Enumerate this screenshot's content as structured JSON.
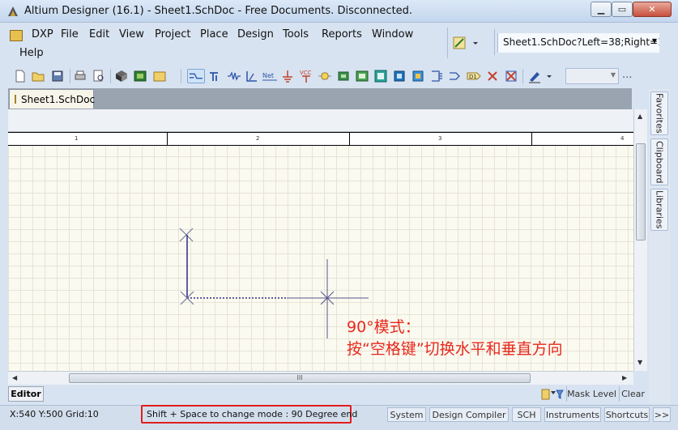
{
  "window": {
    "title": "Altium Designer (16.1) - Sheet1.SchDoc - Free Documents. Disconnected.",
    "min_glyph": "▁",
    "max_glyph": "▭",
    "close_glyph": "✕"
  },
  "menu": {
    "items": [
      "DXP",
      "File",
      "Edit",
      "View",
      "Project",
      "Place",
      "Design",
      "Tools",
      "Reports",
      "Window",
      "Help"
    ]
  },
  "address": {
    "value": "Sheet1.SchDoc?Left=38;Right=1"
  },
  "toolbar": {
    "overflow": "..."
  },
  "document_tab": {
    "label": "Sheet1.SchDoc"
  },
  "ruler": {
    "labels": [
      "1",
      "2",
      "3",
      "4"
    ]
  },
  "annotation": {
    "line1": "90°模式：",
    "line2": "按“空格键”切换水平和垂直方向"
  },
  "side_panels": [
    "Favorites",
    "Clipboard",
    "Libraries"
  ],
  "hscroll": {
    "grip": "III"
  },
  "editor_row": {
    "tab": "Editor",
    "mask_level": "Mask Level",
    "clear": "Clear"
  },
  "status": {
    "coords": "X:540 Y:500",
    "grid": "Grid:10",
    "mode": "Shift + Space to change mode : 90 Degree end",
    "buttons": [
      "System",
      "Design Compiler",
      "SCH",
      "Instruments",
      "Shortcuts",
      ">>"
    ]
  },
  "colors": {
    "annotation": "#e8281c",
    "highlight_box": "#e01e1e",
    "wire": "#2b2b8a",
    "sheet_bg": "#fbfaf0"
  }
}
